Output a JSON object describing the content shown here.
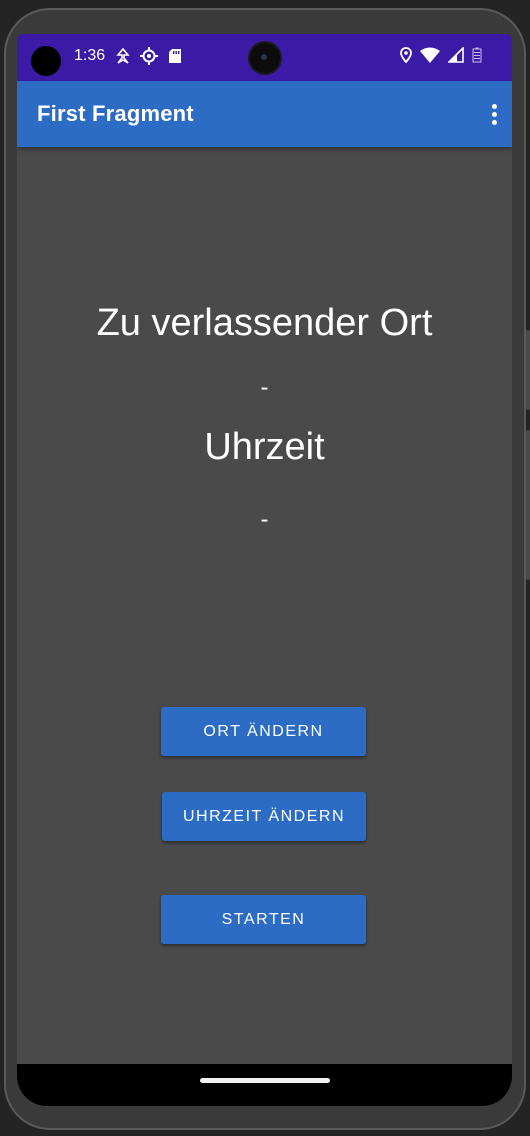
{
  "status_bar": {
    "time": "1:36",
    "left_icons": [
      "navigation-icon",
      "settings-icon",
      "sd-card-icon"
    ],
    "right_icons": [
      "location-icon",
      "wifi-icon",
      "signal-icon",
      "battery-icon"
    ],
    "background": "#3b1aa6"
  },
  "app_bar": {
    "title": "First Fragment",
    "menu_icon": "more-vert-icon",
    "background": "#2c6cc5"
  },
  "main": {
    "place_heading": "Zu verlassender Ort",
    "place_value": "-",
    "time_heading": "Uhrzeit",
    "time_value": "-",
    "background": "#4a4a4a"
  },
  "buttons": {
    "change_place": "ORT ÄNDERN",
    "change_time": "UHRZEIT ÄNDERN",
    "start": "STARTEN",
    "color": "#2c6cc5"
  }
}
